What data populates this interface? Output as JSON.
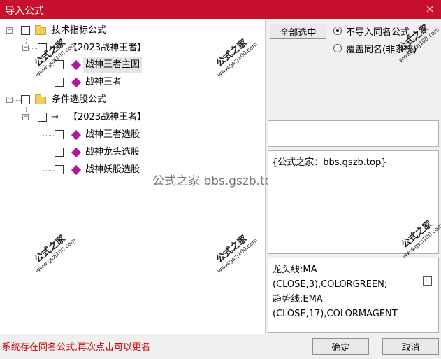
{
  "window": {
    "title": "导入公式",
    "close_glyph": "×"
  },
  "tree": {
    "nodes": [
      {
        "label": "技术指标公式",
        "icon": "folder-icon"
      },
      {
        "label": "【2023战神王者】",
        "icon": "key-icon"
      },
      {
        "label": "战神王者主图",
        "icon": "gem-icon"
      },
      {
        "label": "战神王者",
        "icon": "gem-icon"
      },
      {
        "label": "条件选股公式",
        "icon": "folder-icon"
      },
      {
        "label": "【2023战神王者】",
        "icon": "key-icon"
      },
      {
        "label": "战神王者选股",
        "icon": "gem-icon"
      },
      {
        "label": "战神龙头选股",
        "icon": "gem-icon"
      },
      {
        "label": "战神妖股选股",
        "icon": "gem-icon"
      }
    ]
  },
  "watermarks": {
    "stamp_text": "公式之家",
    "stamp_url": "www.gszj100.com",
    "center_text": "公式之家 bbs.gszb.top"
  },
  "options": {
    "select_all_label": "全部选中",
    "radio_skip_label": "不导入同名公式",
    "radio_overwrite_label": "覆盖同名(非系统)",
    "selected": "skip"
  },
  "description": {
    "text": "{公式之家：bbs.gszb.top}"
  },
  "code_preview": {
    "lines": [
      "龙头线:MA",
      "(CLOSE,3),COLORGREEN;",
      "趋势线:EMA",
      "(CLOSE,17),COLORMAGENT"
    ]
  },
  "footer": {
    "status": "系统存在同名公式,再次点击可以更名",
    "ok_label": "确定",
    "cancel_label": "取消"
  },
  "colors": {
    "title_bar": "#c8102e",
    "status_text": "#d00000",
    "gem": "#b0189c",
    "folder": "#f2cf55"
  }
}
